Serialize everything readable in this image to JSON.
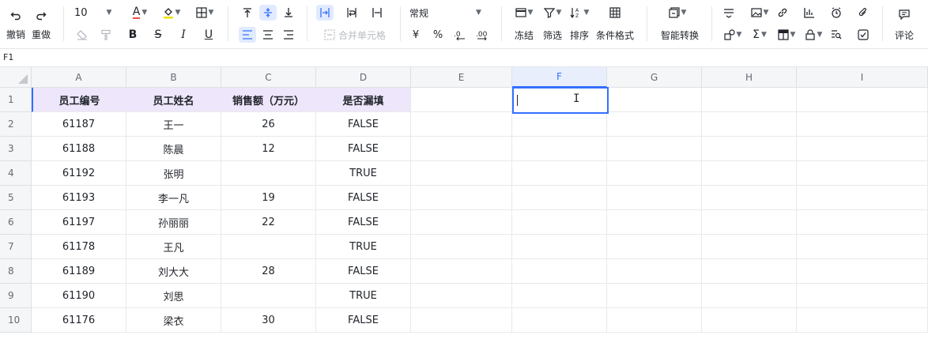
{
  "toolbar": {
    "undo_label": "撤销",
    "redo_label": "重做",
    "font_size": "10",
    "font_color_icon": "A",
    "bold_icon": "B",
    "strike_icon": "S",
    "italic_icon": "I",
    "underline_icon": "U",
    "number_format": "常规",
    "currency_icon": "¥",
    "percent_icon": "%",
    "merge_label": "合并单元格",
    "freeze_label": "冻结",
    "filter_label": "筛选",
    "sort_label": "排序",
    "cond_format_label": "条件格式",
    "smart_convert_label": "智能转换",
    "comment_label": "评论",
    "font_color": "#f54a45",
    "fill_color": "#f2e000",
    "accent": "#3370ff"
  },
  "formula_bar": {
    "cell_ref": "F1"
  },
  "grid": {
    "columns": [
      "A",
      "B",
      "C",
      "D",
      "E",
      "F",
      "G",
      "H",
      "I"
    ],
    "rows": [
      "1",
      "2",
      "3",
      "4",
      "5",
      "6",
      "7",
      "8",
      "9",
      "10"
    ],
    "selected_cell": "F1",
    "header_fill": "#eee6fb",
    "header": [
      "员工编号",
      "员工姓名",
      "销售额（万元）",
      "是否漏填"
    ],
    "data": [
      [
        "61187",
        "王一",
        "26",
        "FALSE"
      ],
      [
        "61188",
        "陈晨",
        "12",
        "FALSE"
      ],
      [
        "61192",
        "张明",
        "",
        "TRUE"
      ],
      [
        "61193",
        "李一凡",
        "19",
        "FALSE"
      ],
      [
        "61197",
        "孙丽丽",
        "22",
        "FALSE"
      ],
      [
        "61178",
        "王凡",
        "",
        "TRUE"
      ],
      [
        "61189",
        "刘大大",
        "28",
        "FALSE"
      ],
      [
        "61190",
        "刘思",
        "",
        "TRUE"
      ],
      [
        "61176",
        "梁衣",
        "30",
        "FALSE"
      ]
    ]
  }
}
